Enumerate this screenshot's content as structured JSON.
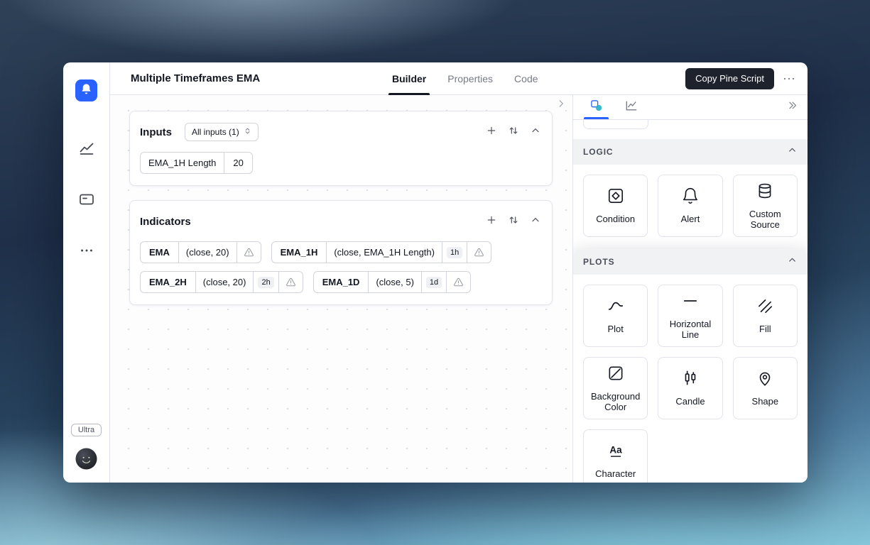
{
  "header": {
    "title": "Multiple Timeframes EMA",
    "tabs": [
      {
        "label": "Builder"
      },
      {
        "label": "Properties"
      },
      {
        "label": "Code"
      }
    ],
    "copy_button_label": "Copy Pine Script",
    "more_label": "⋯"
  },
  "rail": {
    "ultra_badge": "Ultra",
    "icons": [
      "app-logo-bell",
      "chart",
      "panels",
      "more-dots"
    ]
  },
  "canvas": {
    "inputs": {
      "title": "Inputs",
      "filter_label": "All inputs (1)",
      "rows": [
        {
          "label": "EMA_1H Length",
          "value": "20"
        }
      ]
    },
    "indicators": {
      "title": "Indicators",
      "chips": [
        {
          "name": "EMA",
          "params": "(close, 20)",
          "timeframe": ""
        },
        {
          "name": "EMA_1H",
          "params": "(close, EMA_1H Length)",
          "timeframe": "1h"
        },
        {
          "name": "EMA_2H",
          "params": "(close, 20)",
          "timeframe": "2h"
        },
        {
          "name": "EMA_1D",
          "params": "(close, 5)",
          "timeframe": "1d"
        }
      ]
    }
  },
  "right_panel": {
    "logic": {
      "title": "LOGIC",
      "cards": [
        {
          "label": "Condition",
          "icon": "condition-icon"
        },
        {
          "label": "Alert",
          "icon": "alert-bell-icon"
        },
        {
          "label": "Custom Source",
          "icon": "custom-source-icon"
        }
      ]
    },
    "plots": {
      "title": "PLOTS",
      "cards": [
        {
          "label": "Plot",
          "icon": "plot-curve-icon"
        },
        {
          "label": "Horizontal Line",
          "icon": "horizontal-line-icon"
        },
        {
          "label": "Fill",
          "icon": "fill-hatch-icon"
        },
        {
          "label": "Background Color",
          "icon": "background-color-icon"
        },
        {
          "label": "Candle",
          "icon": "candle-icon"
        },
        {
          "label": "Shape",
          "icon": "shape-pin-icon"
        },
        {
          "label": "Character",
          "icon": "character-icon"
        }
      ]
    }
  },
  "colors": {
    "accent_blue": "#2962ff",
    "button_dark": "#1e222d",
    "border": "#e0e3eb",
    "chip_border": "#d1d4dc",
    "timeframe_badge_bg": "#eef0f3",
    "section_header_bg": "#f0f2f4"
  }
}
